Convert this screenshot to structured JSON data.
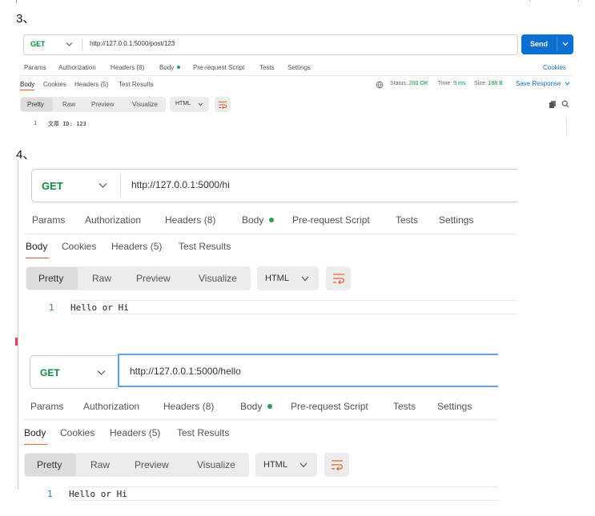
{
  "step3": {
    "label": "3、",
    "method": "GET",
    "url": "http://127.0.0.1:5000/post/123",
    "send": "Send",
    "tabs": [
      "Params",
      "Authorization",
      "Headers (8)",
      "Body",
      "Pre-request Script",
      "Tests",
      "Settings"
    ],
    "cookies": "Cookies",
    "resp_tabs": [
      "Body",
      "Cookies",
      "Headers (5)",
      "Test Results"
    ],
    "status_label": "Status:",
    "status_value": "200 OK",
    "time_label": "Time:",
    "time_value": "5 ms",
    "size_label": "Size:",
    "size_value": "188 B",
    "save_response": "Save Response",
    "view_tabs": [
      "Pretty",
      "Raw",
      "Preview",
      "Visualize"
    ],
    "format": "HTML",
    "line_no": "1",
    "content": "文章 ID: 123"
  },
  "step4": {
    "label": "4、",
    "request1": {
      "method": "GET",
      "url": "http://127.0.0.1:5000/hi",
      "tabs": [
        "Params",
        "Authorization",
        "Headers (8)",
        "Body",
        "Pre-request Script",
        "Tests",
        "Settings"
      ],
      "resp_tabs": [
        "Body",
        "Cookies",
        "Headers (5)",
        "Test Results"
      ],
      "view_tabs": [
        "Pretty",
        "Raw",
        "Preview",
        "Visualize"
      ],
      "format": "HTML",
      "line_no": "1",
      "content": "Hello or Hi"
    },
    "request2": {
      "method": "GET",
      "url": "http://127.0.0.1:5000/hello",
      "tabs": [
        "Params",
        "Authorization",
        "Headers (8)",
        "Body",
        "Pre-request Script",
        "Tests",
        "Settings"
      ],
      "resp_tabs": [
        "Body",
        "Cookies",
        "Headers (5)",
        "Test Results"
      ],
      "view_tabs": [
        "Pretty",
        "Raw",
        "Preview",
        "Visualize"
      ],
      "format": "HTML",
      "line_no": "1",
      "content": "Hello or Hi"
    }
  },
  "colors": {
    "accent": "#e8612c",
    "send_blue": "#0d6fd1",
    "get_green": "#0c8a3e",
    "status_green": "#0c8a3e",
    "focus_blue": "#6aa0e0"
  },
  "icons": [
    "chevron-down-icon",
    "wrap-icon",
    "copy-icon",
    "search-icon",
    "globe-icon"
  ]
}
